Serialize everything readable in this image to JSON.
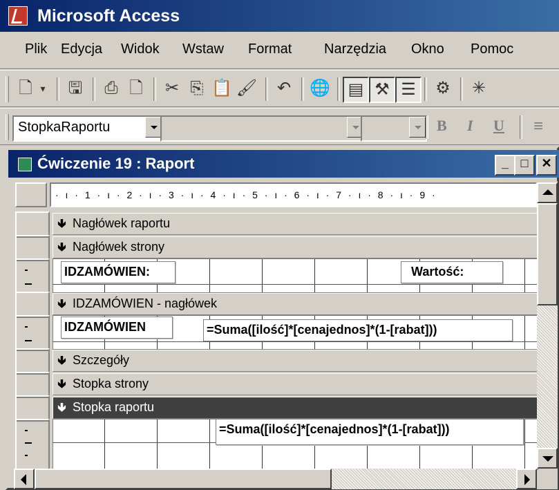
{
  "app": {
    "title": "Microsoft Access"
  },
  "menu": [
    "Plik",
    "Edycja",
    "Widok",
    "Wstaw",
    "Format",
    "Narzędzia",
    "Okno",
    "Pomoc"
  ],
  "toolbar": {
    "object_combo": "StopkaRaportu",
    "bold": "B",
    "italic": "I",
    "underline": "U",
    "icons": [
      "print-preview-icon",
      "dropdown-icon",
      "save-icon",
      "print-icon",
      "preview-icon",
      "cut-icon",
      "copy-icon",
      "paste-icon",
      "format-painter-icon",
      "undo-icon",
      "web-icon",
      "properties-icon",
      "toolbox-icon",
      "field-list-icon",
      "build-icon"
    ]
  },
  "window": {
    "title": "Ćwiczenie 19 : Raport"
  },
  "ruler": "· ı · 1 · ı · 2 · ı · 3 · ı · 4 · ı · 5 · ı · 6 · ı · 7 · ı · 8 · ı · 9 ·",
  "sections": {
    "report_header": "Nagłówek raportu",
    "page_header": "Nagłówek strony",
    "group_header": "IDZAMÓWIEN - nagłówek",
    "detail": "Szczegóły",
    "page_footer": "Stopka strony",
    "report_footer": "Stopka raportu"
  },
  "controls": {
    "label_id": "IDZAMÓWIEN:",
    "label_value": "Wartość:",
    "field_id": "IDZAMÓWIEN",
    "sum_group": "=Suma([ilość]*[cenajednos]*(1-[rabat]))",
    "sum_report": "=Suma([ilość]*[cenajednos]*(1-[rabat]))"
  },
  "colors": {
    "title_bar": "#0a246a",
    "selected_band": "#404040"
  }
}
